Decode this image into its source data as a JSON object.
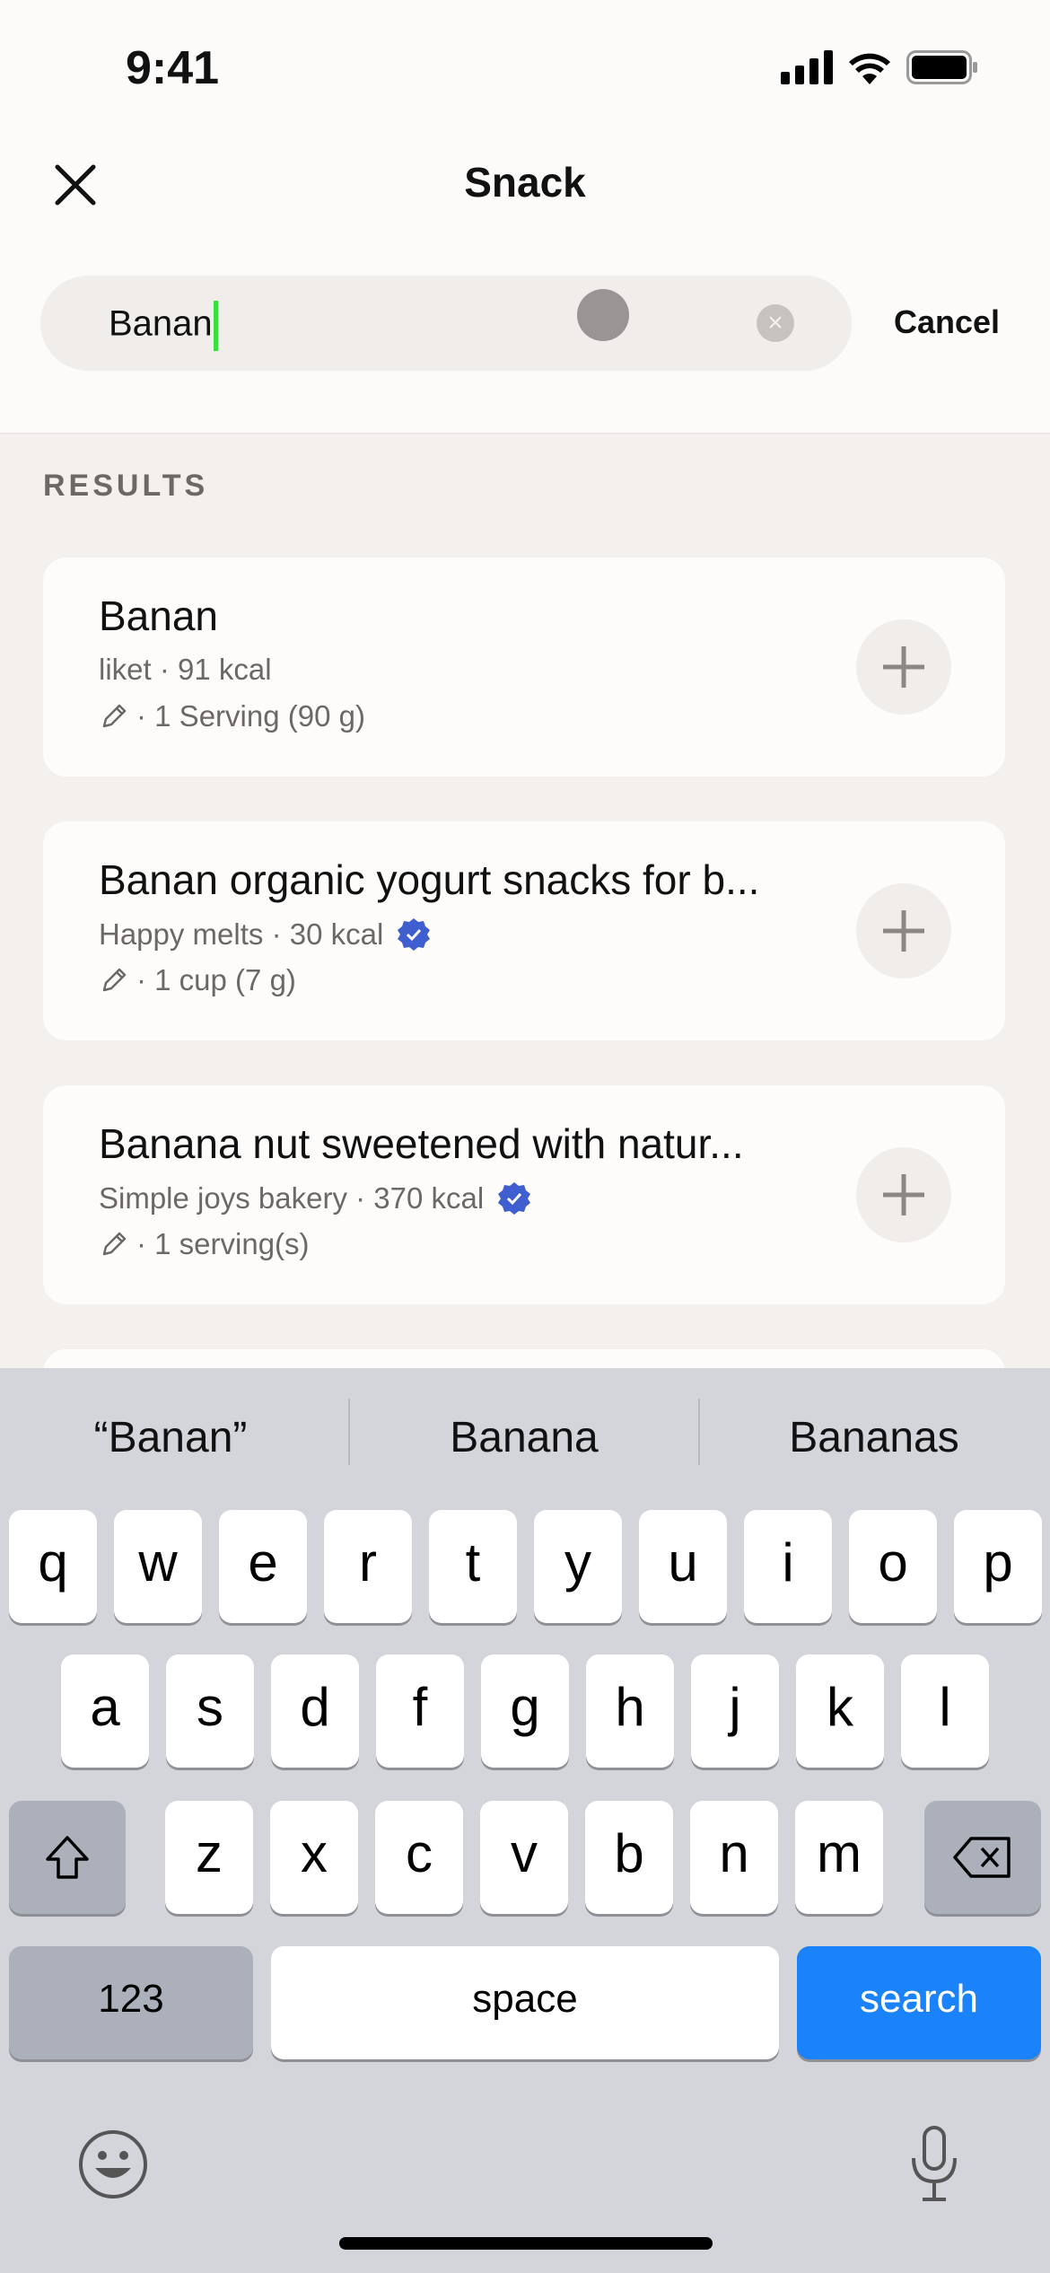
{
  "status": {
    "time": "9:41"
  },
  "header": {
    "title": "Snack",
    "close_icon": "close-icon"
  },
  "search": {
    "value": "Banan",
    "cancel": "Cancel"
  },
  "results_label": "RESULTS",
  "results": [
    {
      "title": "Banan",
      "subtitle": "liket · 91 kcal",
      "verified": false,
      "serving": "· 1 Serving (90 g)"
    },
    {
      "title": "Banan organic yogurt snacks for b...",
      "subtitle": "Happy melts · 30 kcal",
      "verified": true,
      "serving": "· 1 cup (7 g)"
    },
    {
      "title": "Banana nut sweetened with natur...",
      "subtitle": "Simple joys bakery · 370 kcal",
      "verified": true,
      "serving": "· 1 serving(s)"
    }
  ],
  "keyboard": {
    "suggestions": [
      "“Banan”",
      "Banana",
      "Bananas"
    ],
    "row1": [
      "q",
      "w",
      "e",
      "r",
      "t",
      "y",
      "u",
      "i",
      "o",
      "p"
    ],
    "row2": [
      "a",
      "s",
      "d",
      "f",
      "g",
      "h",
      "j",
      "k",
      "l"
    ],
    "row3": [
      "z",
      "x",
      "c",
      "v",
      "b",
      "n",
      "m"
    ],
    "numbers": "123",
    "space": "space",
    "search": "search",
    "search_color": "#1a82fb",
    "verified_color": "#3f5fd0"
  }
}
